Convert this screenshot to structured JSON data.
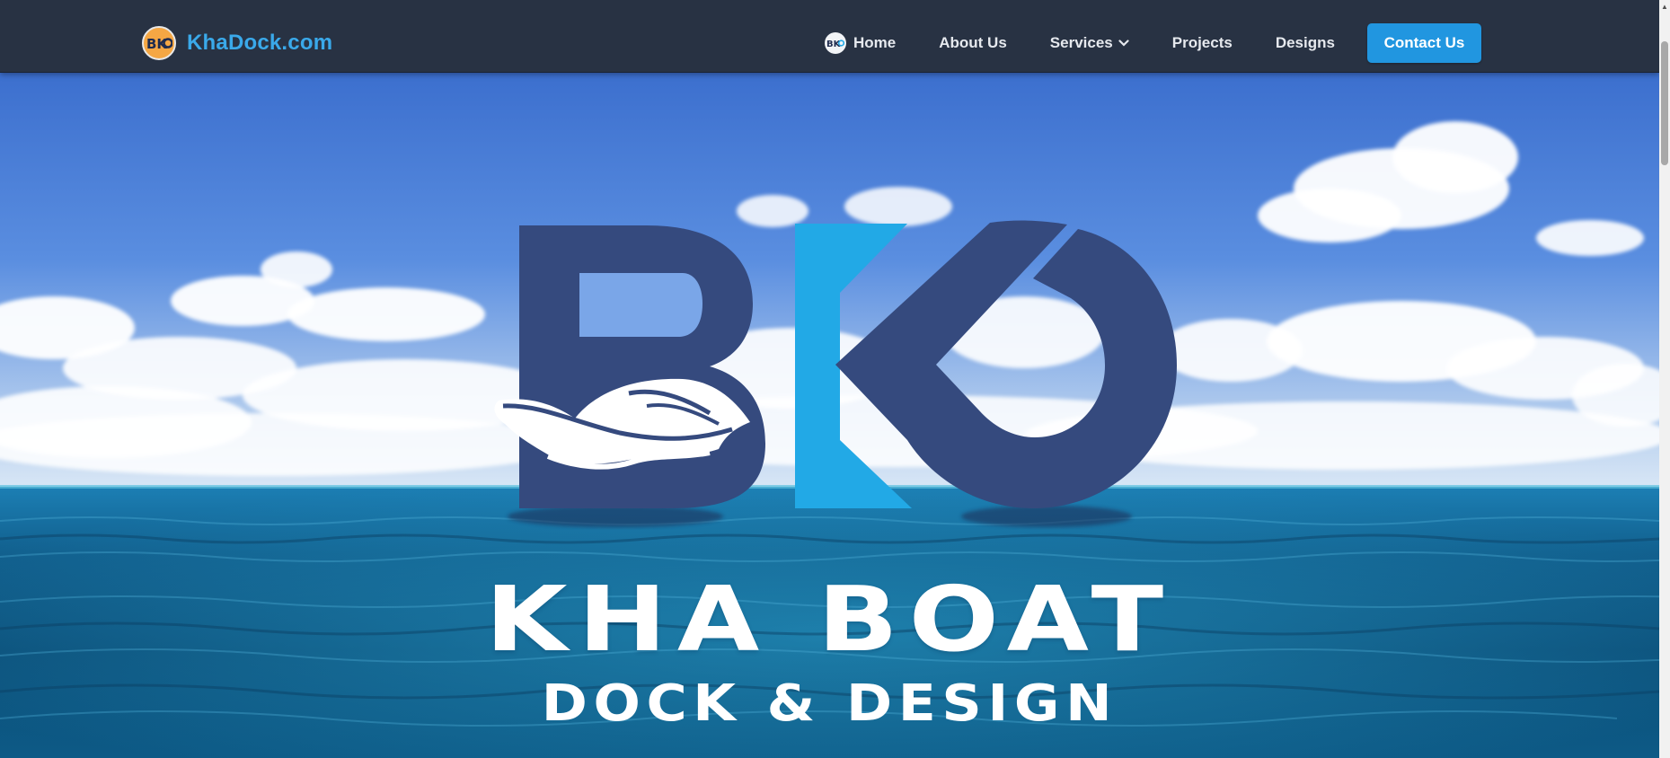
{
  "navbar": {
    "brand": {
      "logo_icon": "bk-logo-icon",
      "name": "KhaDock.com"
    },
    "links": {
      "home": "Home",
      "about": "About Us",
      "services": "Services",
      "projects": "Projects",
      "designs": "Designs"
    },
    "contact_button": "Contact Us"
  },
  "hero": {
    "logo_icon": "bk-boat-logo",
    "title": "KHA BOAT",
    "subtitle": "DOCK & DESIGN"
  },
  "colors": {
    "navbar_bg": "#283243",
    "brand_text": "#3aa9ea",
    "contact_button": "#2196e0",
    "logo_navy": "#354a7e",
    "logo_cyan": "#22a9e6",
    "sky_top": "#3f74cf",
    "ocean": "#0f5d87"
  }
}
